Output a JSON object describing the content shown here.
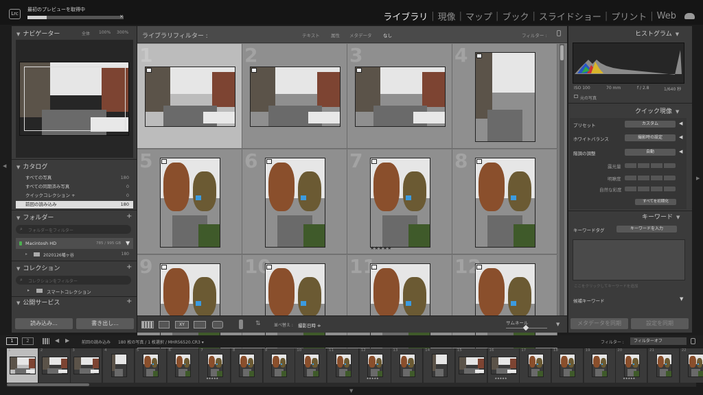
{
  "topbar": {
    "logo": "Lrc",
    "status": "最初のプレビューを取得中",
    "progress": 0.2,
    "close_icon": "×",
    "modules": [
      "ライブラリ",
      "現像",
      "マップ",
      "ブック",
      "スライドショー",
      "プリント",
      "Web"
    ],
    "active_module": "ライブラリ"
  },
  "navigator": {
    "title": "ナビゲーター",
    "zooms": [
      "全体",
      "100%",
      "300%"
    ]
  },
  "catalog": {
    "title": "カタログ",
    "items": [
      {
        "label": "すべての写真",
        "count": "180"
      },
      {
        "label": "すべての同期済み写真",
        "count": "0"
      },
      {
        "label": "クイックコレクション +",
        "count": "0"
      },
      {
        "label": "前回の読み込み",
        "count": "180"
      }
    ]
  },
  "folders": {
    "title": "フォルダー",
    "search_placeholder": "フォルダーをフィルター",
    "drive_name": "Macintosh HD",
    "drive_space": "785 / 995 GB",
    "folder_name": "2020126幡ヶ谷",
    "folder_count": "180"
  },
  "collections": {
    "title": "コレクション",
    "search_placeholder": "コレクションをフィルター",
    "item": "スマートコレクション"
  },
  "publish": {
    "title": "公開サービス"
  },
  "left_buttons": {
    "import": "読み込み...",
    "export": "書き出し..."
  },
  "filterbar": {
    "title": "ライブラリフィルター :",
    "tabs": [
      "テキスト",
      "属性",
      "メタデータ",
      "なし"
    ],
    "filter_label": "フィルター :"
  },
  "grid": {
    "cells": [
      {
        "num": "1",
        "kind": "street",
        "selected": true,
        "stars": ""
      },
      {
        "num": "2",
        "kind": "street",
        "selected": false,
        "stars": ""
      },
      {
        "num": "3",
        "kind": "street",
        "selected": false,
        "stars": ""
      },
      {
        "num": "4",
        "kind": "portrait-street",
        "selected": false,
        "stars": ""
      },
      {
        "num": "5",
        "kind": "autumn",
        "selected": false,
        "stars": ""
      },
      {
        "num": "6",
        "kind": "autumn",
        "selected": false,
        "stars": ""
      },
      {
        "num": "7",
        "kind": "autumn",
        "selected": false,
        "stars": "★★★★★"
      },
      {
        "num": "8",
        "kind": "autumn",
        "selected": false,
        "stars": ""
      },
      {
        "num": "9",
        "kind": "autumn",
        "selected": false,
        "stars": ""
      },
      {
        "num": "10",
        "kind": "autumn",
        "selected": false,
        "stars": ""
      },
      {
        "num": "11",
        "kind": "autumn",
        "selected": false,
        "stars": ""
      },
      {
        "num": "12",
        "kind": "autumn",
        "selected": false,
        "stars": ""
      }
    ]
  },
  "toolbar": {
    "sort_label": "並べ替え :",
    "sort_value": "撮影日時 ≑",
    "thumbnail_label": "サムネール"
  },
  "histogram": {
    "title": "ヒストグラム",
    "iso": "ISO 100",
    "focal": "70 mm",
    "aperture": "f / 2.8",
    "shutter": "1/640 秒",
    "original": "元の写真"
  },
  "quick_develop": {
    "title": "クイック現像",
    "preset_label": "プリセット",
    "preset_value": "カスタム",
    "wb_label": "ホワイトバランス",
    "wb_value": "撮影時の設定",
    "tone_label": "階調の調整",
    "auto_label": "自動",
    "exposure": "露光量",
    "clarity": "明瞭度",
    "vibrance": "自然な彩度",
    "reset": "すべてを初期化"
  },
  "keywording": {
    "title": "キーワード",
    "tags_label": "キーワードタグ",
    "tags_value": "キーワードを入力",
    "add_placeholder": "ここをクリックしてキーワードを追加",
    "suggested": "候補キーワード"
  },
  "right_buttons": {
    "sync_metadata": "メタデータを同期",
    "sync_settings": "設定を同期"
  },
  "filmstrip": {
    "page1": "1",
    "page2": "2",
    "source": "前回の読み込み",
    "info": "180 枚の写真 / 1 枚選択 / MHR56520.CR3 ▾",
    "filter_label": "フィルター :",
    "filter_value": "フィルターオフ",
    "frames": [
      {
        "num": "1",
        "kind": "street",
        "sel": true,
        "stars": ""
      },
      {
        "num": "2",
        "kind": "street",
        "sel": false,
        "stars": ""
      },
      {
        "num": "3",
        "kind": "street",
        "sel": false,
        "stars": ""
      },
      {
        "num": "4",
        "kind": "portrait-street",
        "sel": false,
        "stars": ""
      },
      {
        "num": "5",
        "kind": "autumn",
        "sel": false,
        "stars": ""
      },
      {
        "num": "6",
        "kind": "autumn",
        "sel": false,
        "stars": ""
      },
      {
        "num": "7",
        "kind": "autumn",
        "sel": false,
        "stars": "★★★★★"
      },
      {
        "num": "8",
        "kind": "autumn",
        "sel": false,
        "stars": ""
      },
      {
        "num": "9",
        "kind": "autumn",
        "sel": false,
        "stars": ""
      },
      {
        "num": "10",
        "kind": "autumn",
        "sel": false,
        "stars": ""
      },
      {
        "num": "11",
        "kind": "autumn",
        "sel": false,
        "stars": ""
      },
      {
        "num": "12",
        "kind": "autumn",
        "sel": false,
        "stars": "★★★★★"
      },
      {
        "num": "13",
        "kind": "autumn",
        "sel": false,
        "stars": ""
      },
      {
        "num": "14",
        "kind": "portrait-street",
        "sel": false,
        "stars": ""
      },
      {
        "num": "15",
        "kind": "street",
        "sel": false,
        "stars": ""
      },
      {
        "num": "16",
        "kind": "street",
        "sel": false,
        "stars": "★★★★★"
      },
      {
        "num": "17",
        "kind": "autumn",
        "sel": false,
        "stars": ""
      },
      {
        "num": "18",
        "kind": "autumn",
        "sel": false,
        "stars": ""
      },
      {
        "num": "19",
        "kind": "autumn",
        "sel": false,
        "stars": ""
      },
      {
        "num": "20",
        "kind": "autumn",
        "sel": false,
        "stars": "★★★★★"
      },
      {
        "num": "21",
        "kind": "autumn",
        "sel": false,
        "stars": ""
      },
      {
        "num": "22",
        "kind": "autumn",
        "sel": false,
        "stars": ""
      }
    ]
  }
}
